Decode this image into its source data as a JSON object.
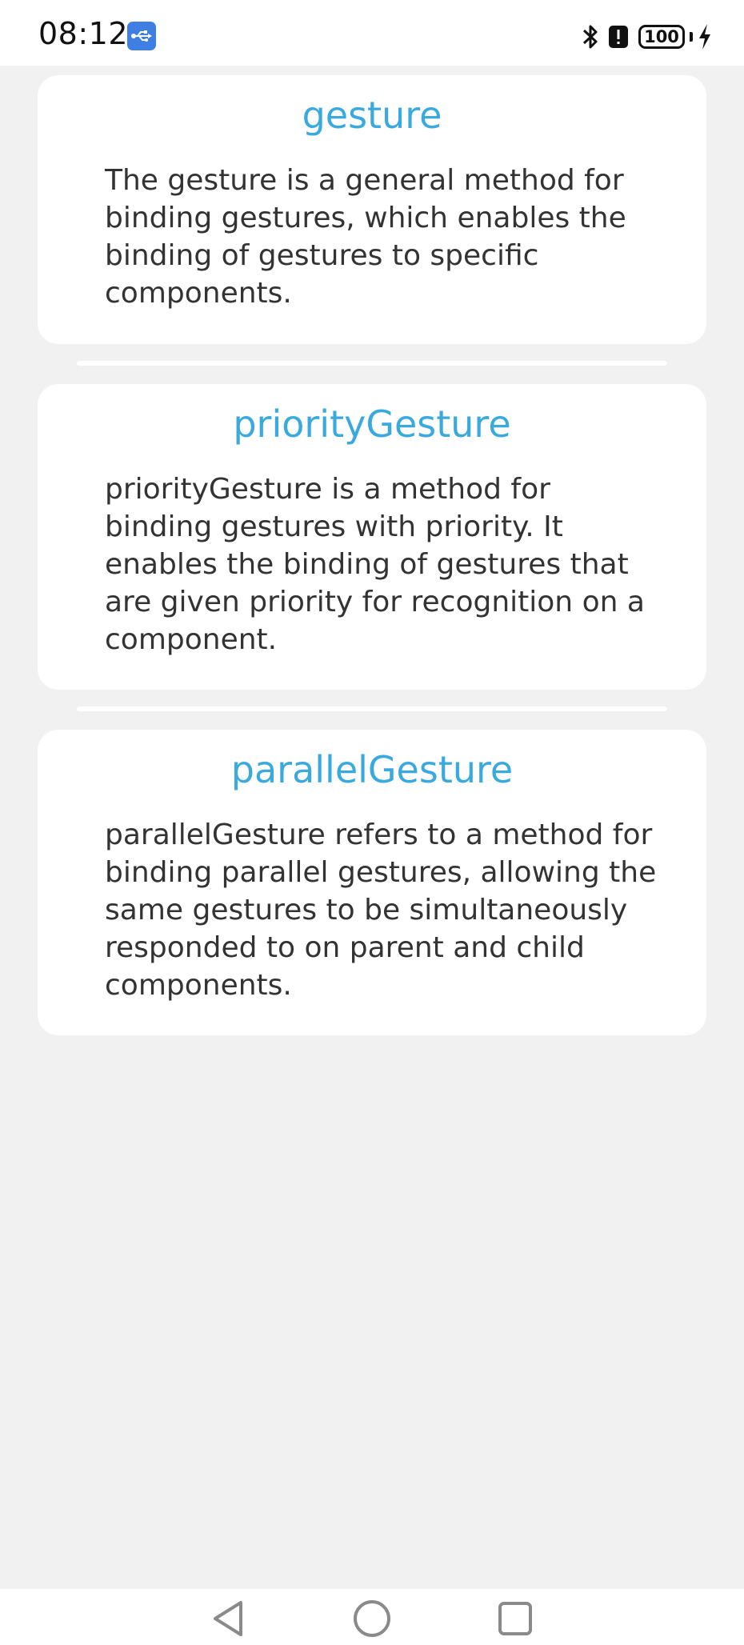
{
  "status_bar": {
    "time": "08:12",
    "battery": "100"
  },
  "cards": [
    {
      "title": "gesture",
      "description": "The gesture is a general method for binding gestures, which enables the binding of gestures to specific components."
    },
    {
      "title": "priorityGesture",
      "description": "priorityGesture is a method for binding gestures with priority. It enables the binding of gestures that are given priority for recognition on a component."
    },
    {
      "title": "parallelGesture",
      "description": "parallelGesture refers to a method for binding parallel gestures, allowing the same gestures to be simultaneously responded to on parent and child components."
    }
  ],
  "colors": {
    "title_accent": "#3aa9de",
    "page_background": "#f1f1f1",
    "card_background": "#ffffff",
    "usb_badge": "#3f7fe3"
  },
  "icons": {
    "usb": "usb-icon",
    "bluetooth": "bluetooth-icon",
    "alert": "alert-icon",
    "battery": "battery-icon",
    "charging": "charging-bolt-icon",
    "back": "back-triangle-icon",
    "home": "home-circle-icon",
    "recents": "recents-square-icon"
  }
}
